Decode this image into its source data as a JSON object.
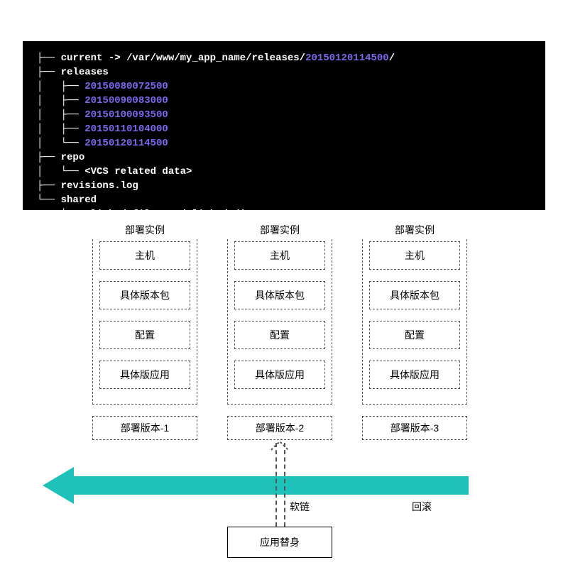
{
  "terminal": {
    "line1_prefix": "current -> ",
    "line1_path": "/var/www/my_app_name/releases/",
    "line1_ts": "20150120114500",
    "line1_slash": "/",
    "releases_label": "releases",
    "releases": [
      "20150080072500",
      "20150090083000",
      "20150100093500",
      "20150110104000",
      "20150120114500"
    ],
    "repo_label": "repo",
    "repo_note": "<VCS related data>",
    "revisions": "revisions.log",
    "shared_label": "shared",
    "shared_note": "<linked_files and linked_dirs>"
  },
  "cols": [
    {
      "title": "部署实例",
      "items": [
        "主机",
        "具体版本包",
        "配置",
        "具体版应用"
      ],
      "version": "部署版本-1"
    },
    {
      "title": "部署实例",
      "items": [
        "主机",
        "具体版本包",
        "配置",
        "具体版应用"
      ],
      "version": "部署版本-2"
    },
    {
      "title": "部署实例",
      "items": [
        "主机",
        "具体版本包",
        "配置",
        "具体版应用"
      ],
      "version": "部署版本-3"
    }
  ],
  "softlink_label": "软链",
  "rollback_label": "回滚",
  "app_stub_label": "应用替身"
}
